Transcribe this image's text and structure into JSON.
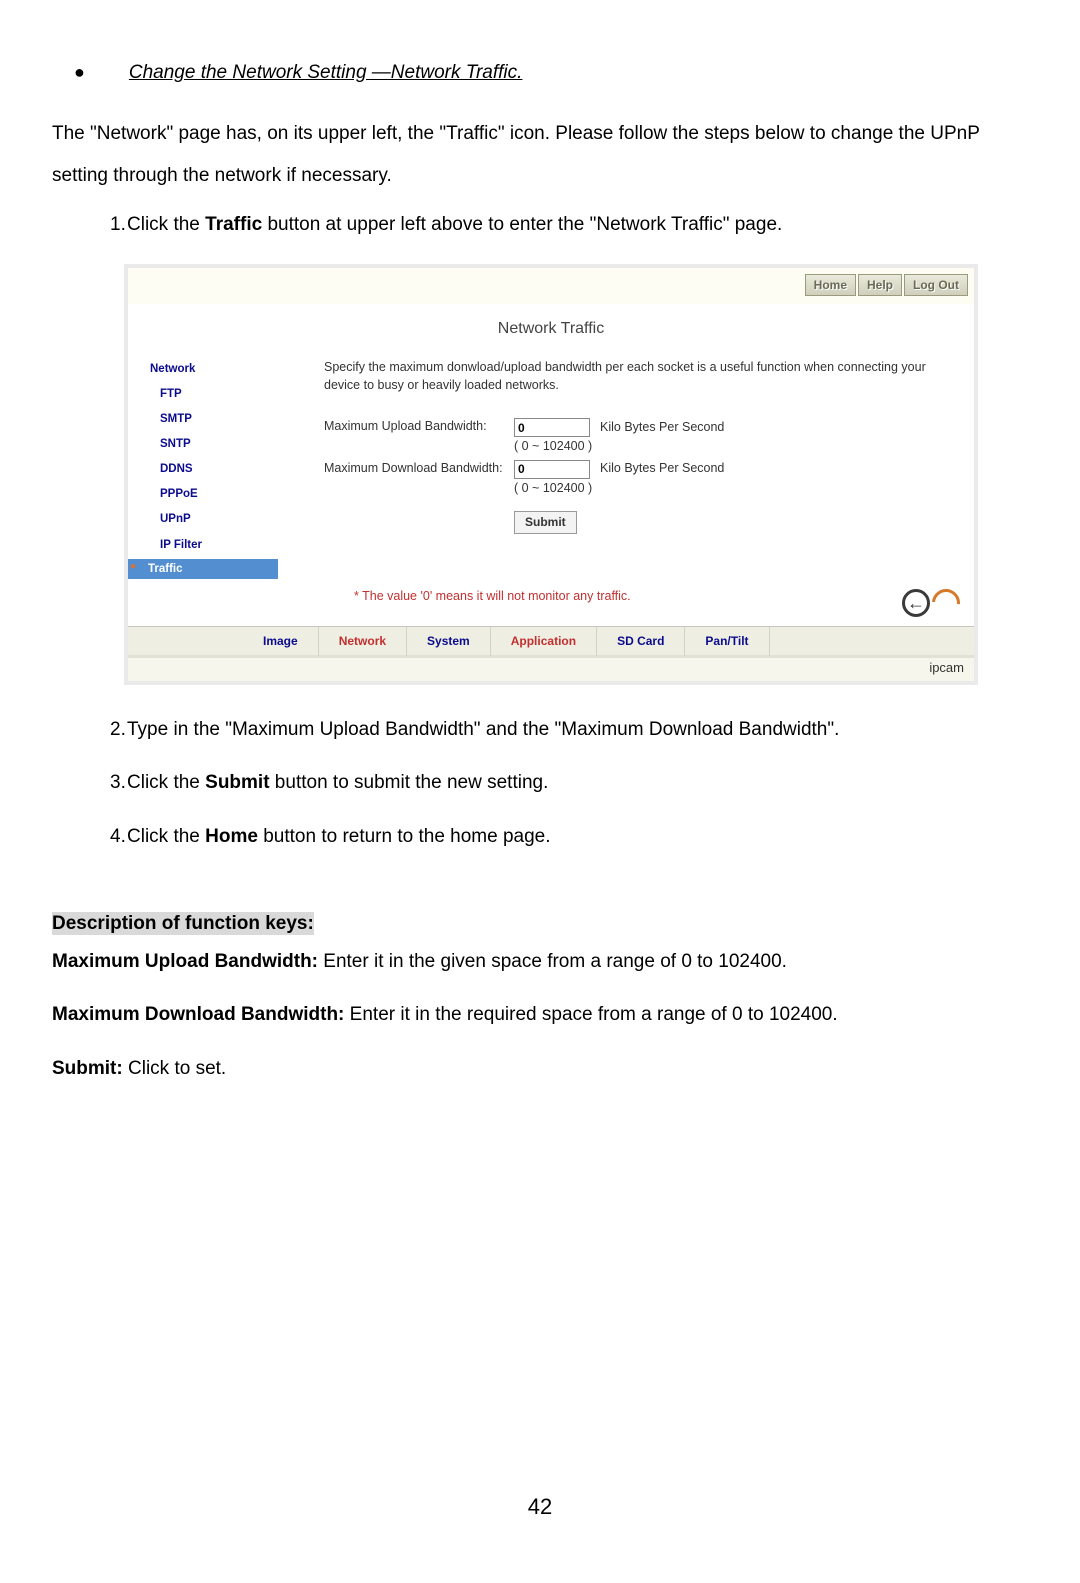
{
  "doc": {
    "bullet_title": "Change the Network Setting —Network Traffic.",
    "intro": "The \"Network\" page has, on its upper left, the \"Traffic\" icon. Please follow the steps below to change the UPnP setting through the network if necessary.",
    "step1_num": "1.",
    "step1_a": "Click the ",
    "step1_b": "Traffic",
    "step1_c": " button at upper left above to enter the \"Network Traffic\" page.",
    "step2_num": "2.",
    "step2": "Type in the \"Maximum Upload Bandwidth\" and the \"Maximum Download Bandwidth\".",
    "step3_num": "3.",
    "step3_a": "Click the ",
    "step3_b": "Submit",
    "step3_c": " button to submit the new setting.",
    "step4_num": "4.",
    "step4_a": "Click the ",
    "step4_b": "Home",
    "step4_c": " button to return to the home page.",
    "desc_heading": "Description of function keys:",
    "d1_label": "Maximum Upload Bandwidth: ",
    "d1_text": "Enter it in the given space from a range of 0 to 102400.",
    "d2_label": "Maximum Download Bandwidth: ",
    "d2_text": "Enter it in the required space from a range of 0 to 102400.",
    "d3_label": "Submit: ",
    "d3_text": "Click to set.",
    "page_num": "42"
  },
  "shot": {
    "nav": {
      "home": "Home",
      "help": "Help",
      "logout": "Log Out"
    },
    "title": "Network Traffic",
    "sidebar": {
      "network": "Network",
      "ftp": "FTP",
      "smtp": "SMTP",
      "sntp": "SNTP",
      "ddns": "DDNS",
      "pppoe": "PPPoE",
      "upnp": "UPnP",
      "ipfilter": "IP Filter",
      "traffic": "Traffic"
    },
    "desc": "Specify the maximum donwload/upload bandwidth per each socket is a useful function when connecting your device to busy or heavily loaded networks.",
    "form": {
      "upload_label": "Maximum Upload Bandwidth:",
      "download_label": "Maximum Download Bandwidth:",
      "upload_value": "0",
      "download_value": "0",
      "unit": "Kilo Bytes Per Second",
      "range": "( 0 ~ 102400 )",
      "submit": "Submit"
    },
    "note": "* The value '0' means it will not monitor any traffic.",
    "bottomnav": {
      "image": "Image",
      "network": "Network",
      "system": "System",
      "application": "Application",
      "sdcard": "SD Card",
      "pantilt": "Pan/Tilt"
    },
    "footer": "ipcam"
  }
}
